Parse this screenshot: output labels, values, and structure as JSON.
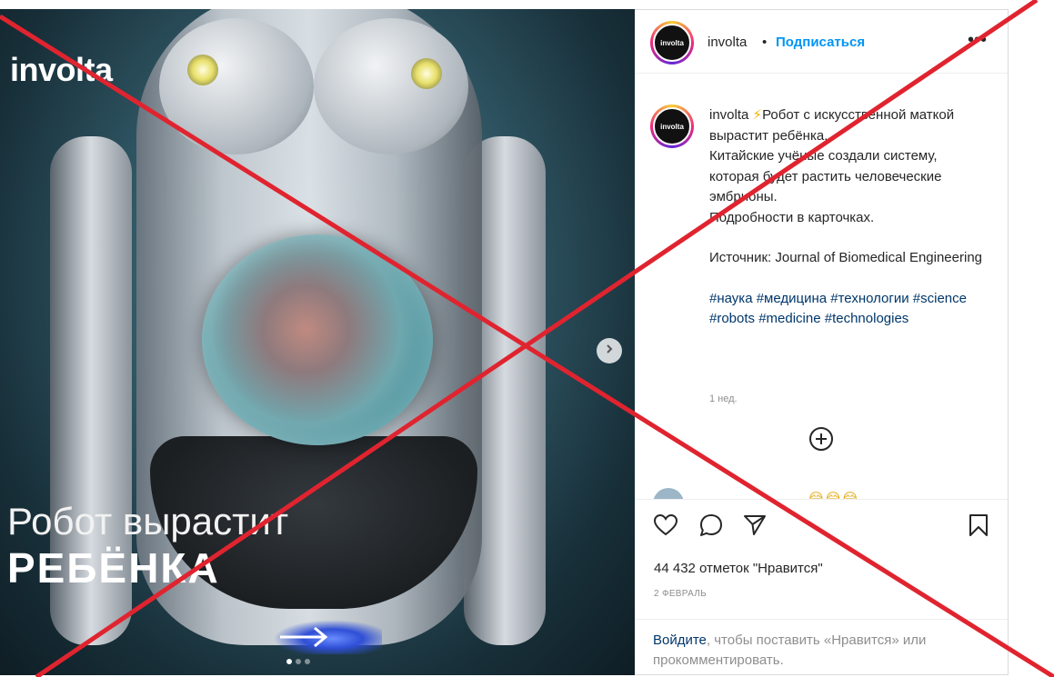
{
  "post": {
    "image": {
      "brand": "involta",
      "headline_line1": "Робот вырастит",
      "headline_line2": "РЕБЁНКА",
      "next_icon": "chevron-right-icon",
      "dots": {
        "count": 3,
        "active": 1
      }
    },
    "header": {
      "avatar_text": "involta",
      "username": "involta",
      "separator": "•",
      "follow_label": "Подписаться",
      "more_label": "•••"
    },
    "caption": {
      "avatar_text": "involta",
      "username": "involta",
      "emoji": "⚡",
      "lines": [
        "Робот с искусственной маткой вырастит ребёнка.",
        "Китайские учёные создали систему, которая будет растить человеческие эмбрионы.",
        "Подробности в карточках."
      ],
      "source": "Источник: Journal of Biomedical Engineering",
      "hashtags": "#наука #медицина #технологии #science #robots #medicine #technologies",
      "time": "1 нед.",
      "load_more_icon": "plus-circle-icon"
    },
    "comment_peek": {
      "emoji": "😂😂😂"
    },
    "actions": {
      "like_icon": "heart-icon",
      "comment_icon": "comment-icon",
      "share_icon": "send-icon",
      "save_icon": "bookmark-icon"
    },
    "likes": "44 432 отметок \"Нравится\"",
    "date": "2 ФЕВРАЛЬ",
    "login_prompt": {
      "link": "Войдите",
      "text": ", чтобы поставить «Нравится» или прокомментировать."
    }
  },
  "overlay": {
    "cross_color": "#e0242f"
  }
}
